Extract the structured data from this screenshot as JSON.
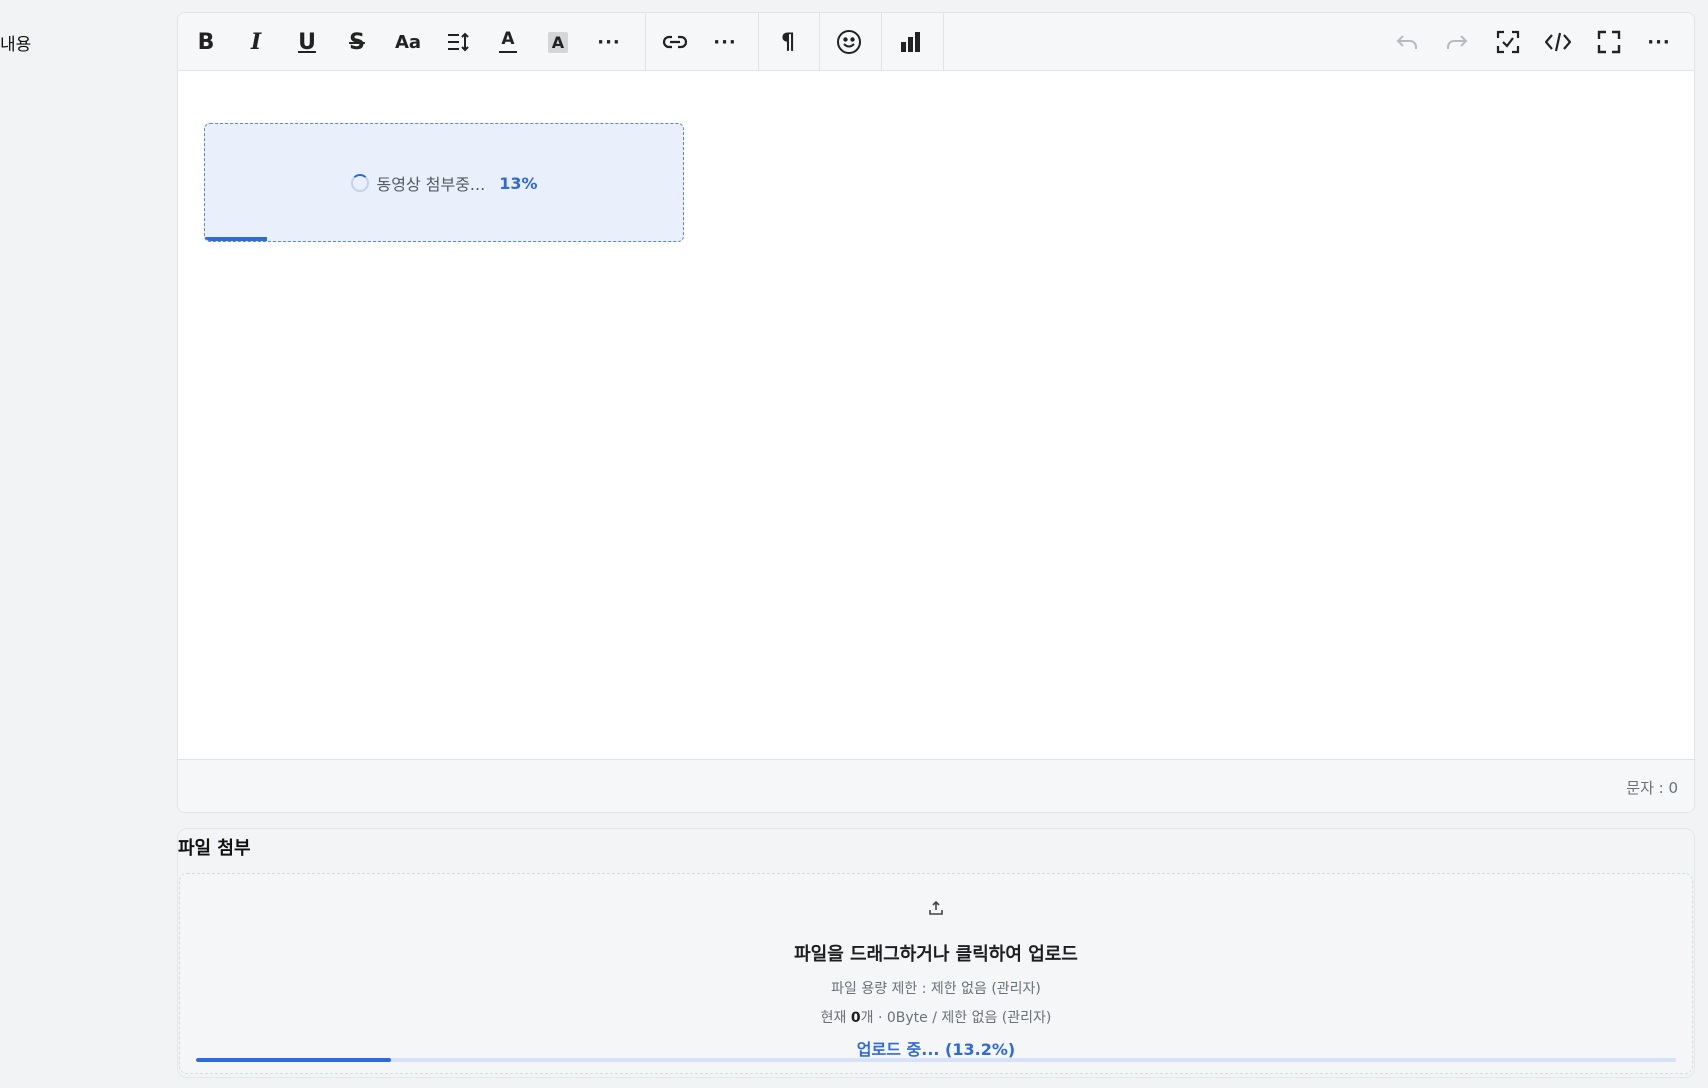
{
  "field": {
    "label": "내용"
  },
  "toolbar": {
    "buttons": [
      {
        "name": "bold",
        "glyph": "B"
      },
      {
        "name": "italic",
        "glyph": "I"
      },
      {
        "name": "underline",
        "glyph": "U"
      },
      {
        "name": "strikethrough",
        "glyph": "S"
      },
      {
        "name": "font-size",
        "glyph": "Aa"
      },
      {
        "name": "line-height",
        "glyph": ""
      },
      {
        "name": "text-color",
        "glyph": "A"
      },
      {
        "name": "background-color",
        "glyph": "A"
      },
      {
        "name": "more-format",
        "glyph": "···"
      },
      {
        "name": "link",
        "glyph": ""
      },
      {
        "name": "more-insert",
        "glyph": "···"
      },
      {
        "name": "paragraph",
        "glyph": "¶"
      },
      {
        "name": "emoji",
        "glyph": ""
      },
      {
        "name": "chart",
        "glyph": ""
      },
      {
        "name": "undo",
        "glyph": ""
      },
      {
        "name": "redo",
        "glyph": ""
      },
      {
        "name": "select-all",
        "glyph": ""
      },
      {
        "name": "code-view",
        "glyph": ""
      },
      {
        "name": "fullscreen",
        "glyph": ""
      },
      {
        "name": "more-options",
        "glyph": "···"
      }
    ]
  },
  "video_upload": {
    "label": "동영상 첨부중...",
    "percent_label": "13%",
    "progress": 0.13
  },
  "statusbar": {
    "char_count": "문자 : 0"
  },
  "attachment": {
    "title": "파일 첨부",
    "dropzone_title": "파일을 드래그하거나 클릭하여 업로드",
    "size_limit": "파일 용량 제한 : 제한 없음 (관리자)",
    "current_prefix": "현재 ",
    "current_count": "0",
    "current_suffix": "개 · 0Byte / 제한 없음 (관리자)",
    "progress_text": "업로드 중... (13.2%)",
    "progress": 0.132
  },
  "colors": {
    "accent": "#2f6ad9",
    "placeholder_bg": "#e9f0fb"
  }
}
